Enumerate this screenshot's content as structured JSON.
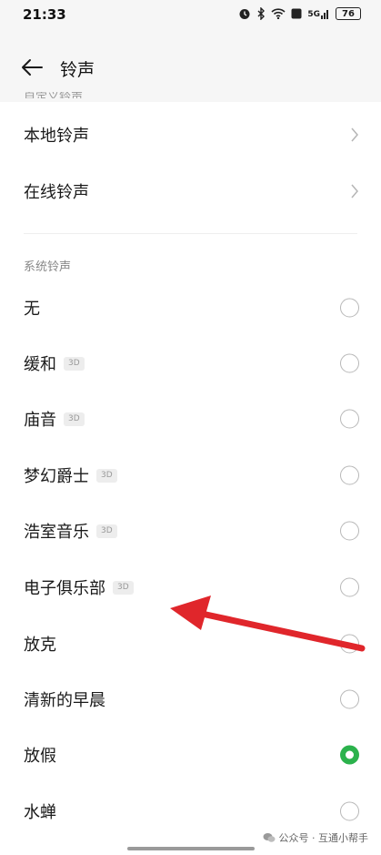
{
  "status": {
    "time": "21:33",
    "battery": "76",
    "network": "5G"
  },
  "header": {
    "title": "铃声",
    "peek_text": "自定义铃声"
  },
  "custom_items": [
    {
      "label": "本地铃声"
    },
    {
      "label": "在线铃声"
    }
  ],
  "system_section": {
    "title": "系统铃声",
    "items": [
      {
        "label": "无",
        "badge": "",
        "selected": false
      },
      {
        "label": "缓和",
        "badge": "3D",
        "selected": false
      },
      {
        "label": "庙音",
        "badge": "3D",
        "selected": false
      },
      {
        "label": "梦幻爵士",
        "badge": "3D",
        "selected": false
      },
      {
        "label": "浩室音乐",
        "badge": "3D",
        "selected": false
      },
      {
        "label": "电子俱乐部",
        "badge": "3D",
        "selected": false
      },
      {
        "label": "放克",
        "badge": "",
        "selected": false
      },
      {
        "label": "清新的早晨",
        "badge": "",
        "selected": false
      },
      {
        "label": "放假",
        "badge": "",
        "selected": true
      },
      {
        "label": "水蝉",
        "badge": "",
        "selected": false
      }
    ]
  },
  "watermark": {
    "text": "公众号 · 互通小帮手"
  },
  "colors": {
    "accent": "#2bb24c",
    "annotation_arrow": "#e0262b"
  }
}
